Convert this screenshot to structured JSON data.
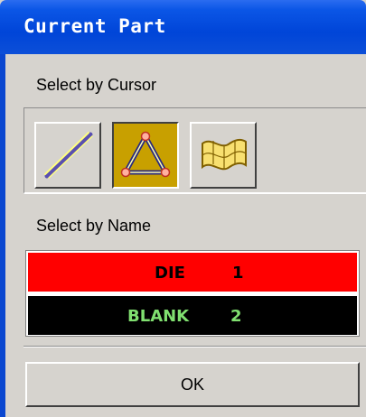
{
  "window": {
    "title": "Current Part"
  },
  "select_by_cursor": {
    "label": "Select by Cursor",
    "tools": [
      {
        "name": "line-select",
        "icon": "line-icon",
        "active": false
      },
      {
        "name": "triangle-select",
        "icon": "triangle-icon",
        "active": true
      },
      {
        "name": "surface-select",
        "icon": "surface-icon",
        "active": false
      }
    ]
  },
  "select_by_name": {
    "label": "Select by Name",
    "parts": [
      {
        "name": "DIE",
        "id": "1",
        "row_color": "#ff0000",
        "text_color": "#000000"
      },
      {
        "name": "BLANK",
        "id": "2",
        "row_color": "#000000",
        "text_color": "#80e070"
      }
    ]
  },
  "ok_button": {
    "label": "OK"
  },
  "colors": {
    "titlebar": "#0045d8",
    "active_tool": "#c8a000",
    "background": "#d6d3ce"
  }
}
